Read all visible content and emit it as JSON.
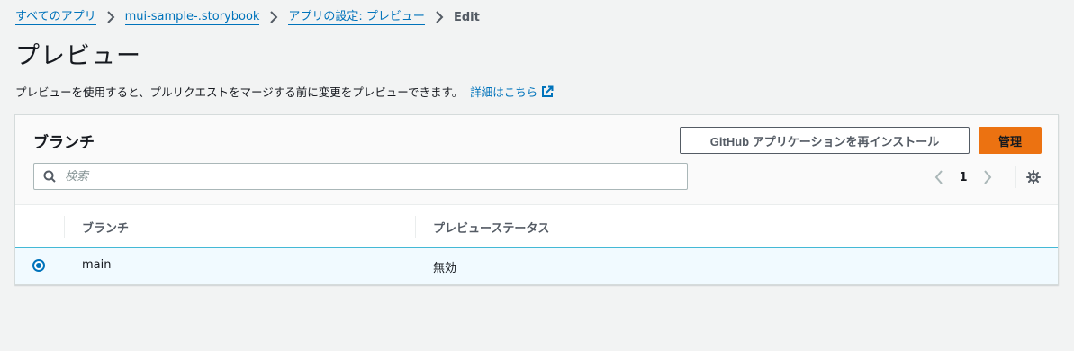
{
  "breadcrumb": {
    "items": [
      "すべてのアプリ",
      "mui-sample-.storybook",
      "アプリの設定: プレビュー"
    ],
    "current": "Edit"
  },
  "page": {
    "title": "プレビュー",
    "description": "プレビューを使用すると、プルリクエストをマージする前に変更をプレビューできます。",
    "learn_more": "詳細はこちら"
  },
  "panel": {
    "title": "ブランチ",
    "reinstall_button": "GitHub アプリケーションを再インストール",
    "manage_button": "管理",
    "search_placeholder": "検索",
    "search_value": "",
    "pagination": {
      "current_page": "1"
    }
  },
  "table": {
    "columns": [
      "ブランチ",
      "プレビューステータス"
    ],
    "rows": [
      {
        "branch": "main",
        "status": "無効",
        "selected": true
      }
    ]
  },
  "colors": {
    "link": "#0073bb",
    "primary_button": "#ec7211",
    "selected_row_bg": "#f1faff",
    "selected_row_border": "#44b9d6",
    "page_bg": "#f2f3f3"
  },
  "icons": [
    "chevron-right-icon",
    "external-link-icon",
    "search-icon",
    "chevron-left-icon",
    "gear-icon",
    "radio-selected-icon"
  ]
}
